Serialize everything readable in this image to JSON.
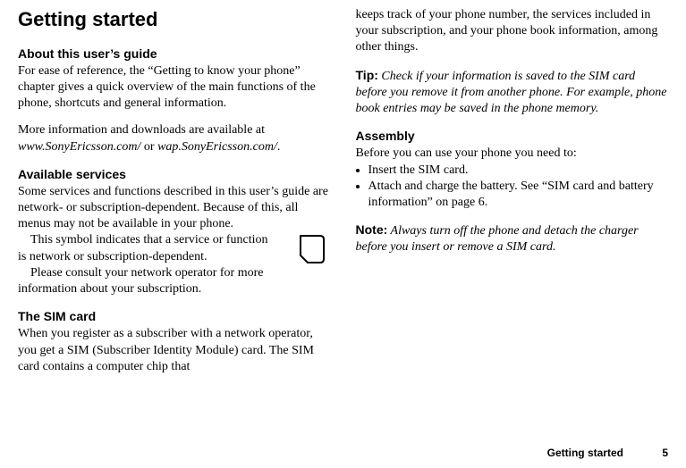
{
  "left": {
    "title": "Getting started",
    "h_about": "About this user’s guide",
    "p_about1": "For ease of reference, the “Getting to know your phone” chapter gives a quick overview of the main functions of the phone, shortcuts and general information.",
    "p_about2a": "More information and downloads are available at ",
    "p_about2b": "www.SonyEricsson.com/",
    "p_about2c": " or ",
    "p_about2d": "wap.SonyEricsson.com/",
    "p_about2e": ".",
    "h_services": "Available services",
    "p_services1": "Some services and functions described in this user’s guide are network- or subscription-dependent. Because of this, all menus may not be available in your phone.",
    "p_services2": "This symbol indicates that a service or function is network or subscription-dependent.",
    "p_services3": "Please consult your network operator for more information about your subscription.",
    "h_sim": "The SIM card",
    "p_sim1": "When you register as a subscriber with a network operator, you get a SIM (Subscriber Identity Module) card. The SIM card contains a computer chip that"
  },
  "right": {
    "p_sim2": "keeps track of your phone number, the services included in your subscription, and your phone book information, among other things.",
    "tip_label": "Tip:",
    "tip_text": " Check if your information is saved to the SIM card before you remove it from another phone. For example, phone book entries may be saved in the phone memory.",
    "h_assembly": "Assembly",
    "p_assembly_intro": "Before you can use your phone you need to:",
    "li1": "Insert the SIM card.",
    "li2": "Attach and charge the battery. See “SIM card and battery information” on page 6.",
    "note_label": "Note:",
    "note_text": " Always turn off the phone and detach the charger before you insert or remove a SIM card."
  },
  "footer": {
    "section": "Getting started",
    "page": "5"
  }
}
